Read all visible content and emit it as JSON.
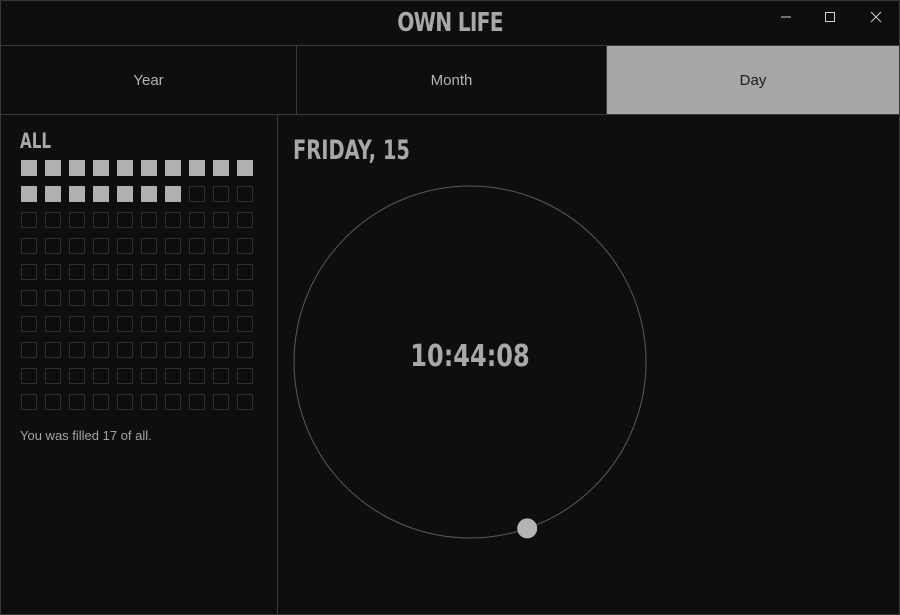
{
  "window": {
    "title": "OWN LIFE",
    "controls": [
      "minimize-icon",
      "maximize-icon",
      "close-icon"
    ]
  },
  "tabs": [
    {
      "label": "Year",
      "active": false
    },
    {
      "label": "Month",
      "active": false
    },
    {
      "label": "Day",
      "active": true
    }
  ],
  "sidebar": {
    "heading": "ALL",
    "grid": {
      "total": 100,
      "filled": 17,
      "columns": 10
    },
    "status_text": "You was filled 17 of all."
  },
  "main": {
    "date_label": "FRIDAY, 15",
    "clock": {
      "time": "10:44:08",
      "day_fraction": 0.4473
    }
  },
  "colors": {
    "background": "#0e0e0e",
    "border": "#3a3a3a",
    "text": "#aaaaaa",
    "active_tab": "#a6a6a6",
    "filled_cell": "#b0b0b0"
  }
}
